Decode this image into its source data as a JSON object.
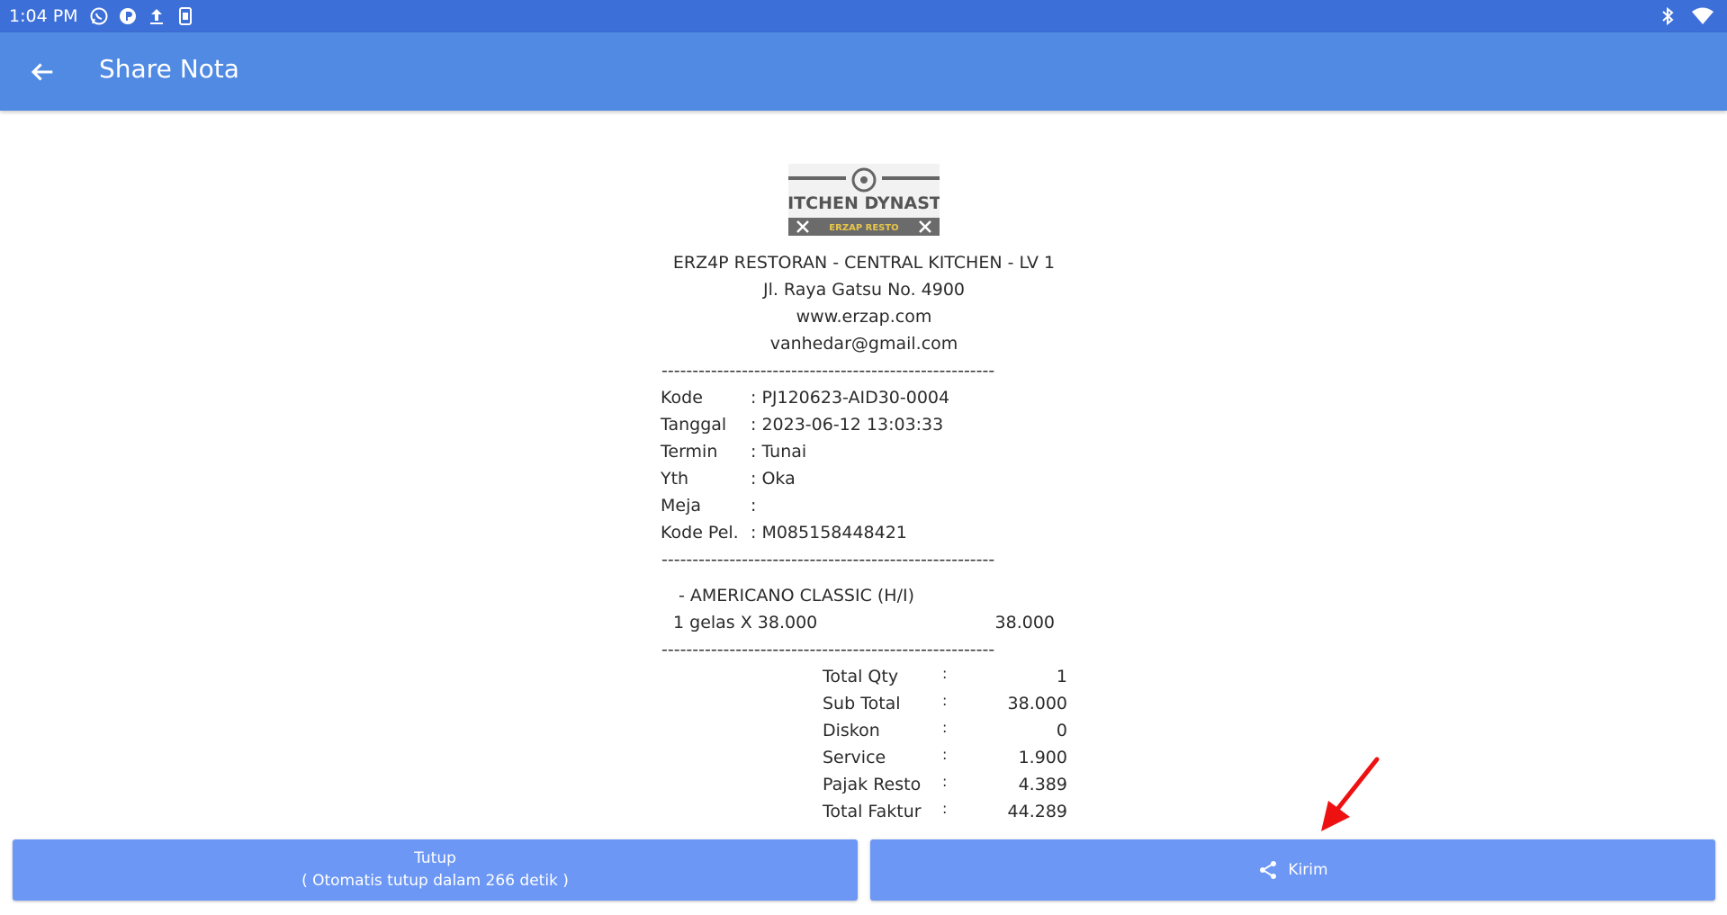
{
  "status_bar": {
    "time": "1:04 PM",
    "left_icons": [
      "whatsapp-icon",
      "app-icon",
      "upload-icon",
      "device-icon"
    ],
    "right_icons": [
      "bluetooth-icon",
      "wifi-icon"
    ]
  },
  "app_bar": {
    "title": "Share Nota",
    "back_icon": "arrow-back-icon"
  },
  "receipt": {
    "logo": {
      "brand": "KITCHEN DYNASTY",
      "tagline": "ERZAP RESTO"
    },
    "header_lines": [
      "ERZ4P RESTORAN - CENTRAL KITCHEN - LV 1",
      "Jl. Raya Gatsu No. 4900",
      "www.erzap.com",
      "vanhedar@gmail.com"
    ],
    "separator": "------------------------------------------------------",
    "info": [
      {
        "label": "Kode",
        "value": ": PJ120623-AID30-0004"
      },
      {
        "label": "Tanggal",
        "value": ": 2023-06-12 13:03:33"
      },
      {
        "label": "Termin",
        "value": ": Tunai"
      },
      {
        "label": "Yth",
        "value": ": Oka"
      },
      {
        "label": "Meja",
        "value": ":"
      },
      {
        "label": "Kode Pel.",
        "value": ": M085158448421"
      }
    ],
    "items": [
      {
        "name": "- AMERICANO CLASSIC (H/I)",
        "qty_line": "1 gelas X 38.000",
        "amount": "38.000"
      }
    ],
    "totals": [
      {
        "label": "Total Qty",
        "colon": ":",
        "value": "1"
      },
      {
        "label": "Sub Total",
        "colon": ":",
        "value": "38.000"
      },
      {
        "label": "Diskon",
        "colon": ":",
        "value": "0"
      },
      {
        "label": "Service",
        "colon": ":",
        "value": "1.900"
      },
      {
        "label": "Pajak Resto",
        "colon": ":",
        "value": "4.389"
      },
      {
        "label": "Total Faktur",
        "colon": ":",
        "value": "44.289"
      }
    ]
  },
  "buttons": {
    "close_line1": "Tutup",
    "close_line2": "( Otomatis tutup dalam 266 detik )",
    "send_label": "Kirim",
    "send_icon": "share-icon"
  },
  "colors": {
    "status_bar": "#3d6fd8",
    "app_bar": "#518ae2",
    "button": "#6c97f5",
    "annotation_arrow": "#ee1111"
  }
}
